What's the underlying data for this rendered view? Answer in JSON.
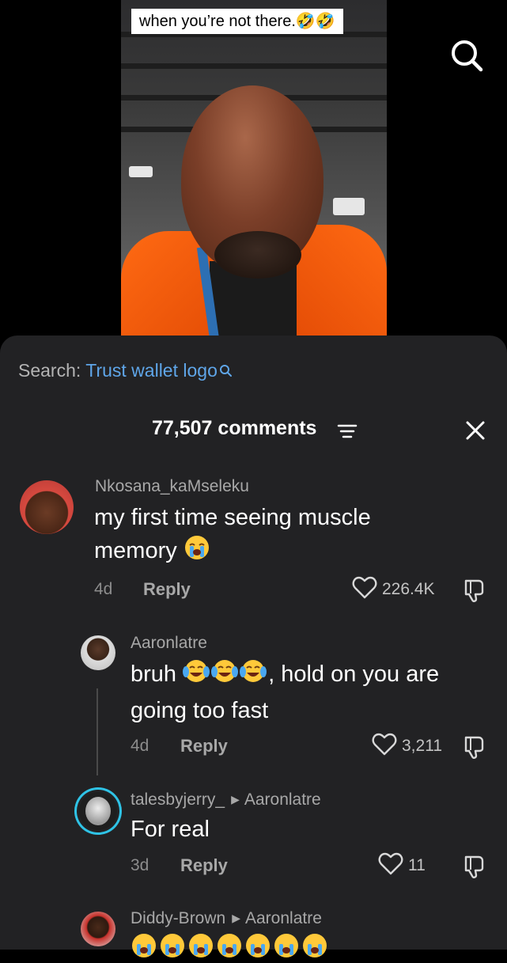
{
  "video": {
    "caption": "when you’re not there.🤣🤣"
  },
  "sheet": {
    "search_label": "Search:",
    "search_query": "Trust wallet logo",
    "comment_count": "77,507 comments"
  },
  "comments": [
    {
      "username": "Nkosana_kaMseleku",
      "text_line1": "my first time seeing muscle",
      "text_line2": "memory",
      "time": "4d",
      "reply_label": "Reply",
      "likes": "226.4K"
    },
    {
      "username": "Aaronlatre",
      "text_before": "bruh",
      "text_after": ", hold on you are",
      "text_line2": "going too fast",
      "time": "4d",
      "reply_label": "Reply",
      "likes": "3,211"
    },
    {
      "username": "talesbyjerry_",
      "reply_to": "Aaronlatre",
      "text": "For real",
      "time": "3d",
      "reply_label": "Reply",
      "likes": "11"
    },
    {
      "username": "Diddy-Brown",
      "reply_to": "Aaronlatre"
    }
  ],
  "icons": {
    "search": "search-icon",
    "filter": "filter-icon",
    "close": "close-icon",
    "heart": "heart-icon",
    "dislike": "dislike-icon",
    "emoji_crying": "loudly-crying-emoji",
    "emoji_laughing": "tears-of-joy-emoji"
  },
  "colors": {
    "sheet_bg": "#222224",
    "link_blue": "#5fa6e9",
    "vest_orange": "#ff6a13"
  }
}
